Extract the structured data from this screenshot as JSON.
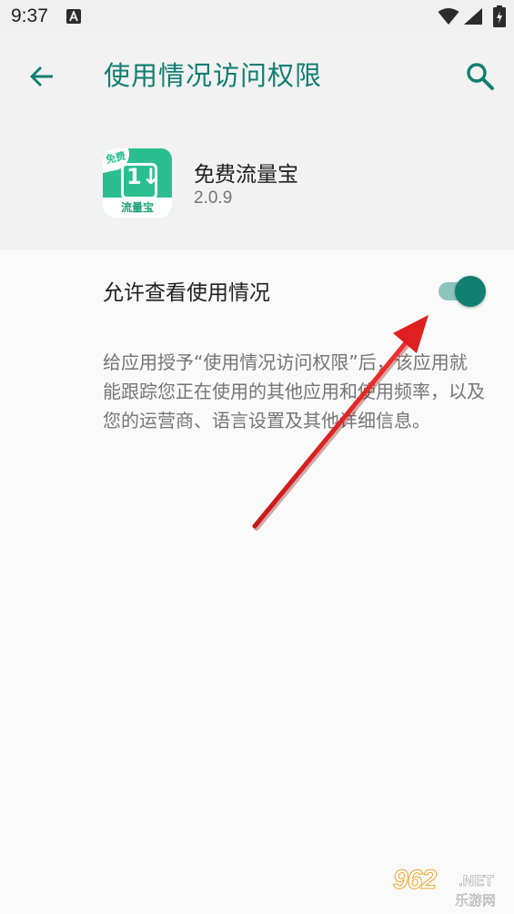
{
  "status_bar": {
    "time": "9:37",
    "icons": [
      "a-notification-icon",
      "wifi-icon",
      "signal-icon",
      "battery-icon"
    ]
  },
  "app_bar": {
    "title": "使用情况访问权限",
    "back_icon": "arrow-back-icon",
    "search_icon": "search-icon",
    "accent_color": "#107e72"
  },
  "app_info": {
    "name": "免费流量宝",
    "version": "2.0.9",
    "icon": {
      "badge_text": "免费",
      "glyph": "1↓",
      "bottom_text": "流量宝",
      "color": "#2bbf8f"
    }
  },
  "permission": {
    "label": "允许查看使用情况",
    "enabled": true,
    "track_color": "#8dc4bd",
    "thumb_color": "#117f72"
  },
  "description": "给应用授予“使用情况访问权限”后，该应用就能跟踪您正在使用的其他应用和使用频率，以及您的运营商、语言设置及其他详细信息。",
  "annotation": {
    "type": "red-arrow",
    "color": "#e02020"
  },
  "watermark": {
    "main": "962",
    "suffix": ".NET",
    "sub": "乐游网"
  }
}
